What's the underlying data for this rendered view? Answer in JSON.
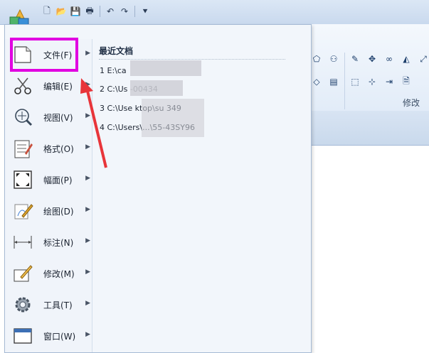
{
  "app": {
    "logo_icon": "cad-app-logo-icon"
  },
  "quick_access": [
    {
      "name": "new-icon",
      "glyph": "🗋"
    },
    {
      "name": "open-icon",
      "glyph": "📂"
    },
    {
      "name": "save-icon",
      "glyph": "💾"
    },
    {
      "name": "print-icon",
      "glyph": "🖶"
    },
    {
      "name": "undo-icon",
      "glyph": "↶"
    },
    {
      "name": "redo-icon",
      "glyph": "↷"
    },
    {
      "name": "customize-icon",
      "glyph": "⯆"
    }
  ],
  "ribbon": {
    "group_label": "修改"
  },
  "menu": {
    "items": [
      {
        "label": "文件(F)",
        "icon": "file-icon"
      },
      {
        "label": "编辑(E)",
        "icon": "scissors-icon"
      },
      {
        "label": "视图(V)",
        "icon": "view-magnifier-icon"
      },
      {
        "label": "格式(O)",
        "icon": "format-icon"
      },
      {
        "label": "幅面(P)",
        "icon": "page-size-icon"
      },
      {
        "label": "绘图(D)",
        "icon": "draw-icon"
      },
      {
        "label": "标注(N)",
        "icon": "dimension-icon"
      },
      {
        "label": "修改(M)",
        "icon": "modify-icon"
      },
      {
        "label": "工具(T)",
        "icon": "gear-icon"
      },
      {
        "label": "窗口(W)",
        "icon": "window-icon"
      }
    ],
    "recent": {
      "title": "最近文档",
      "items": [
        {
          "text": "1 E:\\ca"
        },
        {
          "text": "2 C:\\Us                    -00434"
        },
        {
          "text": "3 C:\\Use           ktop\\su         349"
        },
        {
          "text": "4 C:\\Users\\...\\55-43SY96"
        }
      ]
    }
  },
  "colors": {
    "highlight": "#e100e1",
    "arrow": "#e8353a"
  }
}
